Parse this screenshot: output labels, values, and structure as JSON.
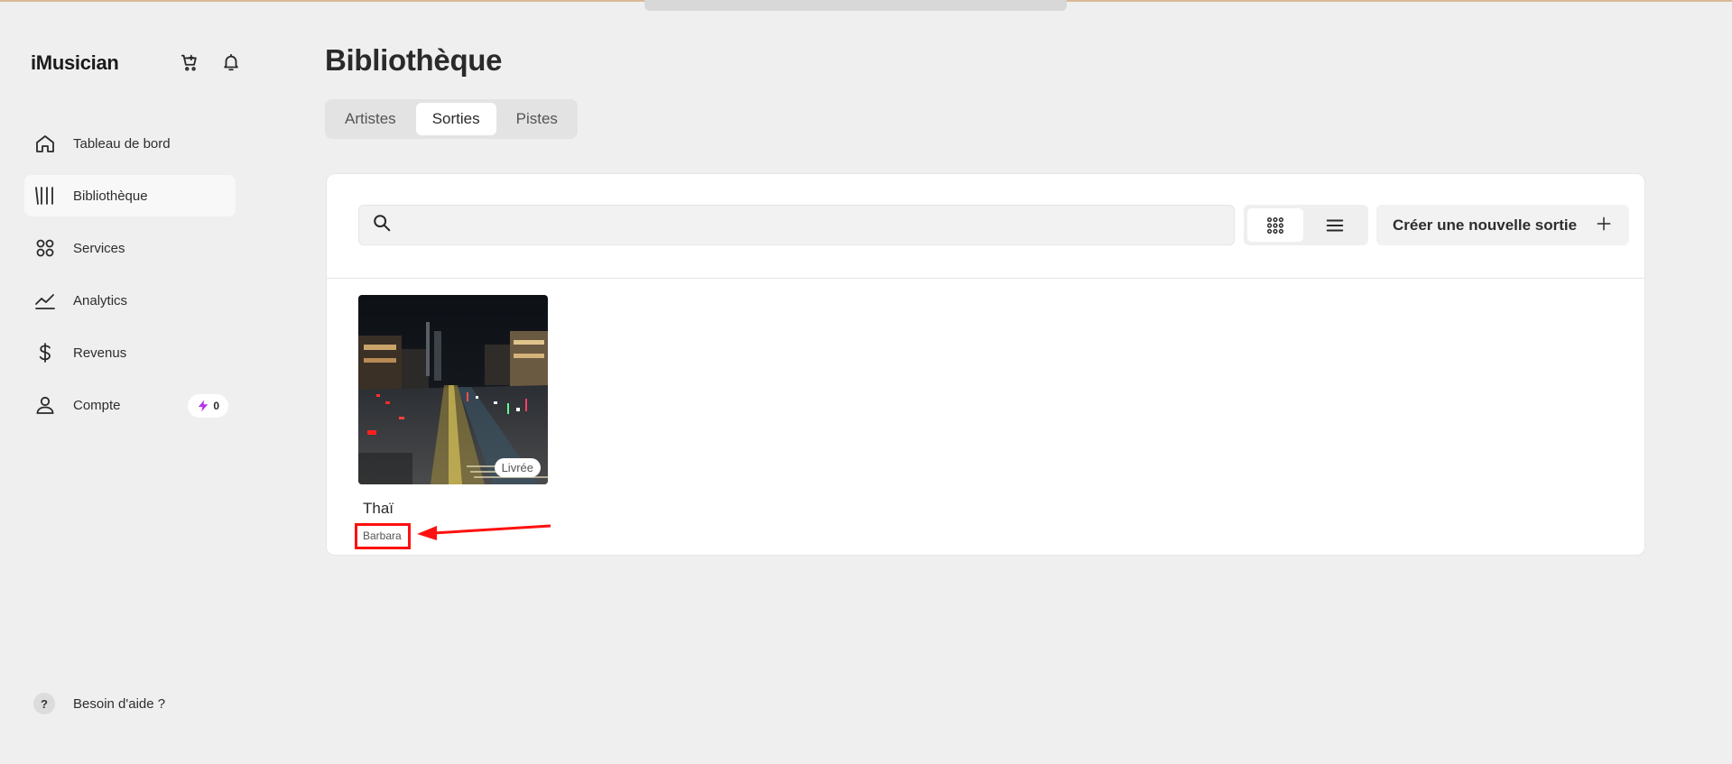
{
  "brand": {
    "name": "iMusician"
  },
  "header_icons": [
    "cart-icon",
    "bell-icon"
  ],
  "sidebar": {
    "items": [
      {
        "label": "Tableau de bord",
        "icon": "home-icon"
      },
      {
        "label": "Bibliothèque",
        "icon": "library-icon",
        "active": true
      },
      {
        "label": "Services",
        "icon": "services-icon"
      },
      {
        "label": "Analytics",
        "icon": "analytics-icon"
      },
      {
        "label": "Revenus",
        "icon": "dollar-icon"
      },
      {
        "label": "Compte",
        "icon": "user-icon",
        "badge": "0"
      }
    ],
    "help_label": "Besoin d'aide ?",
    "help_icon_text": "?"
  },
  "page": {
    "title": "Bibliothèque",
    "tabs": [
      {
        "label": "Artistes"
      },
      {
        "label": "Sorties",
        "active": true
      },
      {
        "label": "Pistes"
      }
    ]
  },
  "toolbar": {
    "search_value": "",
    "search_placeholder": "",
    "create_label": "Créer une nouvelle sortie"
  },
  "releases": [
    {
      "title": "Thaï",
      "artist": "Barbara",
      "status": "Livrée"
    }
  ],
  "colors": {
    "background": "#efefef",
    "panel": "#ffffff",
    "highlight": "#ff1010",
    "badge_bolt": "#b534e8"
  }
}
